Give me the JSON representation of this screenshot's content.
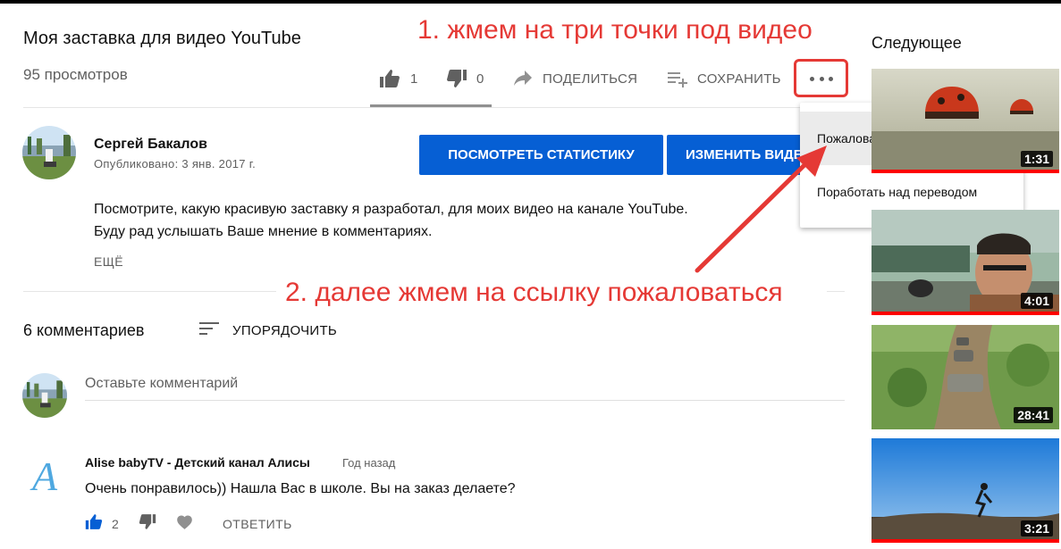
{
  "video": {
    "title": "Моя заставка для видео YouTube",
    "views": "95 просмотров"
  },
  "actions": {
    "like_count": "1",
    "dislike_count": "0",
    "share_label": "ПОДЕЛИТЬСЯ",
    "save_label": "СОХРАНИТЬ"
  },
  "annotations": {
    "step1": "1. жмем на три точки под видео",
    "step2": "2. далее жмем на ссылку пожаловаться"
  },
  "channel": {
    "name": "Сергей Бакалов",
    "published": "Опубликовано: 3 янв. 2017 г.",
    "stats_button": "ПОСМОТРЕТЬ СТАТИСТИКУ",
    "edit_button": "ИЗМЕНИТЬ ВИДЕО"
  },
  "description": {
    "line1": "Посмотрите, какую красивую заставку я разработал, для моих видео на канале YouTube.",
    "line2": "Буду рад услышать Ваше мнение в комментариях.",
    "more": "ЕЩЁ"
  },
  "menu": {
    "items": [
      "Пожаловаться",
      "Поработать над переводом"
    ]
  },
  "comments": {
    "count": "6 комментариев",
    "sort_label": "УПОРЯДОЧИТЬ",
    "input_placeholder": "Оставьте комментарий",
    "items": [
      {
        "author": "Alise babyTV - Детский канал Алисы",
        "time": "Год назад",
        "text": "Очень понравилось))  Нашла Вас в школе. Вы на заказ делаете?",
        "likes": "2",
        "reply": "ОТВЕТИТЬ",
        "avatar_letter": "A"
      }
    ]
  },
  "sidebar": {
    "heading": "Следующее",
    "videos": [
      {
        "duration": "1:31",
        "watched": 1.0
      },
      {
        "duration": "4:01",
        "watched": 1.0
      },
      {
        "duration": "28:41",
        "watched": 0
      },
      {
        "duration": "3:21",
        "watched": 1.0
      }
    ]
  },
  "colors": {
    "primary_button": "#065fd4",
    "annotation_red": "#e53935",
    "like_active": "#065fd4",
    "progress_red": "#ff0000"
  }
}
